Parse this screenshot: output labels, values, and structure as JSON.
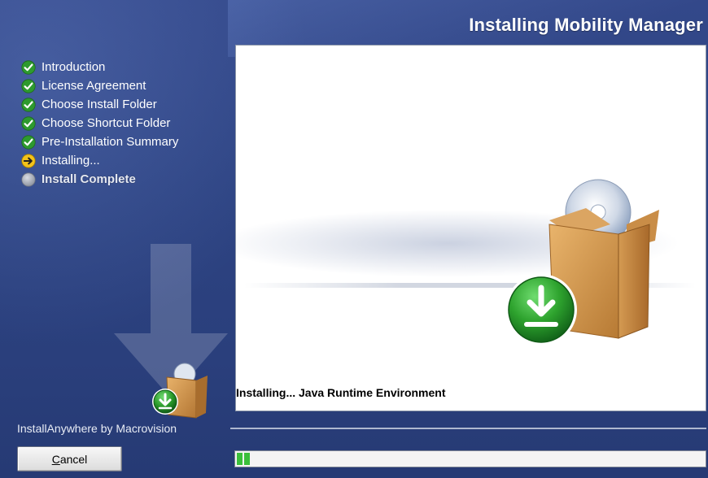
{
  "window": {
    "title": "Installing Mobility Manager"
  },
  "steps": [
    {
      "label": "Introduction",
      "state": "done",
      "icon": "check-icon"
    },
    {
      "label": "License Agreement",
      "state": "done",
      "icon": "check-icon"
    },
    {
      "label": "Choose Install Folder",
      "state": "done",
      "icon": "check-icon"
    },
    {
      "label": "Choose Shortcut Folder",
      "state": "done",
      "icon": "check-icon"
    },
    {
      "label": "Pre-Installation Summary",
      "state": "done",
      "icon": "check-icon"
    },
    {
      "label": "Installing...",
      "state": "current",
      "icon": "arrow-right-icon"
    },
    {
      "label": "Install Complete",
      "state": "pending",
      "icon": "circle-icon"
    }
  ],
  "content": {
    "status_text": "Installing...  Java Runtime Environment"
  },
  "footer": {
    "brand": "InstallAnywhere by Macrovision",
    "cancel_label": "Cancel",
    "cancel_mnemonic": "C",
    "cancel_rest": "ancel"
  },
  "progress": {
    "fraction": 0.03
  },
  "colors": {
    "done": "#2e9a2e",
    "current": "#f2c21a",
    "pending": "#9aa0aa",
    "progress": "#3bbf3b",
    "background": "#2d4382"
  }
}
